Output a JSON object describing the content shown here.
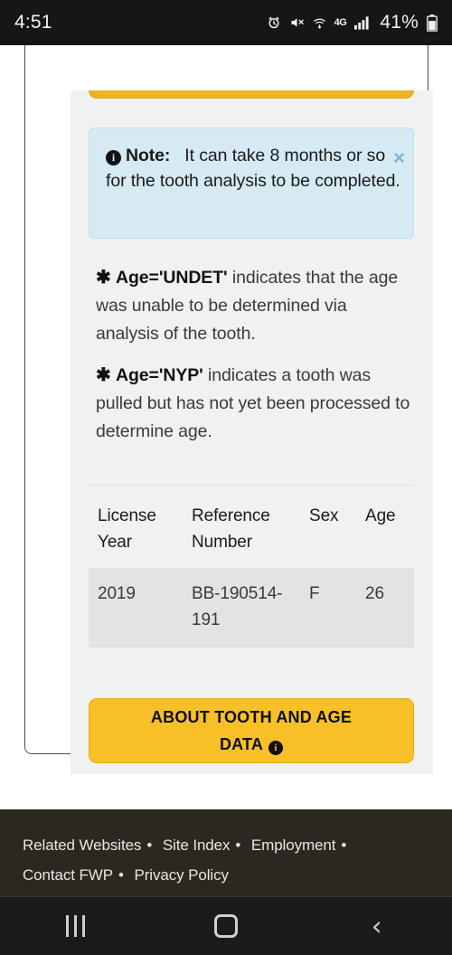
{
  "status_bar": {
    "time": "4:51",
    "battery_percent": "41%",
    "network_label": "4G",
    "icons": [
      "alarm-icon",
      "mute-icon",
      "wifi-icon",
      "network-4g-icon",
      "signal-bars-icon",
      "battery-icon"
    ]
  },
  "note": {
    "icon": "info-icon",
    "label": "Note:",
    "text": "It can take 8 months or so for the tooth analysis to be completed.",
    "full": "Note:   It can take 8 months or so for the tooth analysis to be completed.",
    "close_label": "×",
    "bg_color": "#d5eaf3",
    "close_color": "#7fb4cd"
  },
  "footnotes": [
    {
      "marker": "✱",
      "key": "Age='UNDET'",
      "body": " indicates that the age was unable to be determined via analysis of the tooth."
    },
    {
      "marker": "✱",
      "key": "Age='NYP'",
      "body": " indicates a tooth was pulled but has not yet been processed to determine age."
    }
  ],
  "table": {
    "headers": [
      "License Year",
      "Reference Number",
      "Sex",
      "Age"
    ],
    "rows": [
      {
        "license_year": "2019",
        "reference_number": "BB-190514-191",
        "sex": "F",
        "age": "26"
      }
    ]
  },
  "cta": {
    "label": "ABOUT TOOTH AND AGE DATA",
    "icon": "info-icon",
    "bg_color": "#f7c028"
  },
  "footer": {
    "links_line1": [
      "Related Websites",
      "Site Index",
      "Employment"
    ],
    "links_line2": [
      "Contact FWP",
      "Privacy Policy"
    ],
    "separator": "•",
    "bg_color": "#2b2822"
  },
  "nav_bar": {
    "recents_label": "recents",
    "home_label": "home",
    "back_label": "‹"
  }
}
